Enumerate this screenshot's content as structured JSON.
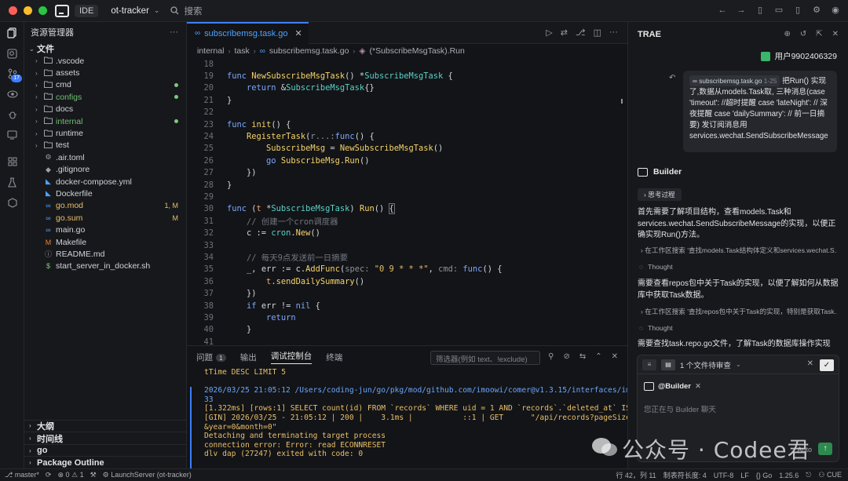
{
  "titlebar": {
    "ide_label": "IDE",
    "project": "ot-tracker",
    "search_placeholder": "搜索"
  },
  "activity": {
    "badge": "17"
  },
  "explorer": {
    "title": "资源管理器",
    "section": "文件",
    "items": [
      {
        "name": ".vscode",
        "type": "folder",
        "color": "#cfd3da"
      },
      {
        "name": "assets",
        "type": "folder",
        "color": "#cfd3da"
      },
      {
        "name": "cmd",
        "type": "folder",
        "color": "#cfd3da",
        "dot": "#7ec97e"
      },
      {
        "name": "configs",
        "type": "folder",
        "color": "#6fbf73",
        "dot": "#7ec97e"
      },
      {
        "name": "docs",
        "type": "folder",
        "color": "#cfd3da"
      },
      {
        "name": "internal",
        "type": "folder",
        "color": "#6fbf73",
        "dot": "#7ec97e"
      },
      {
        "name": "runtime",
        "type": "folder",
        "color": "#cfd3da"
      },
      {
        "name": "test",
        "type": "folder",
        "color": "#cfd3da"
      },
      {
        "name": ".air.toml",
        "type": "file",
        "color": "#cfd3da",
        "icon": "⚙"
      },
      {
        "name": ".gitignore",
        "type": "file",
        "color": "#cfd3da",
        "icon": "◆"
      },
      {
        "name": "docker-compose.yml",
        "type": "file",
        "color": "#cfd3da",
        "icon": "🐳"
      },
      {
        "name": "Dockerfile",
        "type": "file",
        "color": "#cfd3da",
        "icon": "🐳"
      },
      {
        "name": "go.mod",
        "type": "file",
        "color": "#e8bf6a",
        "icon": "∞",
        "badge": "1, M"
      },
      {
        "name": "go.sum",
        "type": "file",
        "color": "#e8bf6a",
        "icon": "∞",
        "badge": "M"
      },
      {
        "name": "main.go",
        "type": "file",
        "color": "#cfd3da",
        "icon": "∞"
      },
      {
        "name": "Makefile",
        "type": "file",
        "color": "#cfd3da",
        "icon": "M"
      },
      {
        "name": "README.md",
        "type": "file",
        "color": "#cfd3da",
        "icon": "ⓘ"
      },
      {
        "name": "start_server_in_docker.sh",
        "type": "file",
        "color": "#cfd3da",
        "icon": "$"
      }
    ],
    "bottom_sections": [
      "大纲",
      "时间线",
      "go",
      "Package Outline"
    ]
  },
  "editor": {
    "tab": "subscribemsg.task.go",
    "breadcrumbs": [
      "internal",
      "task",
      "subscribemsg.task.go",
      "(*SubscribeMsgTask).Run"
    ]
  },
  "panel": {
    "tabs": [
      "问题",
      "输出",
      "调试控制台",
      "终端"
    ],
    "problems_badge": "1",
    "filter_placeholder": "筛选器(例如 text、!exclude)",
    "console": [
      "tTime DESC LIMIT 5",
      "",
      "2026/03/25 21:05:12 /Users/coding-jun/go/pkg/mod/github.com/imoowi/comer@v1.3.15/interfaces/impl/repo.go:",
      "33",
      "[1.322ms] [rows:1] SELECT count(id) FROM `records` WHERE uid = 1 AND `records`.`deleted_at` IS NULL",
      "[GIN] 2026/03/25 - 21:05:12 | 200 |    3.1ms |           ::1 | GET      \"/api/records?pageSize=5&page=1",
      "&year=0&month=0\"",
      "Detaching and terminating target process",
      "connection error: Error: read ECONNRESET",
      "dlv dap (27247) exited with code: 0"
    ]
  },
  "chat": {
    "title": "TRAE",
    "user": "用户9902406329",
    "user_message_chip": "subscribemsg.task.go",
    "user_message_chip_range": "1-25",
    "user_message": "把Run() 实现了,数据从models.Task取, 三种消息(case 'timeout': //超时提醒 case 'lateNight': // 深夜提醒 case 'dailySummary': // 前一日摘要) 发订阅消息用 services.wechat.SendSubscribeMessage",
    "builder": "Builder",
    "think_label": "思考过程",
    "para1": "首先需要了解项目结构，查看models.Task和services.wechat.SendSubscribeMessage的实现，以便正确实现Run()方法。",
    "step1": "在工作区搜索 '查找models.Task结构体定义和services.wechat.S...",
    "thought": "Thought",
    "para2": "需要查看repos包中关于Task的实现，以便了解如何从数据库中获取Task数据。",
    "step2": "在工作区搜索 '查找repos包中关于Task的实现，特别是获取Task...",
    "para3": "需要查找task.repo.go文件，了解Task的数据库操作实现",
    "review_label": "1 个文件待审查",
    "input_builder": "@Builder",
    "input_placeholder": "您正在与 Builder 聊天",
    "auto_label": "Auto"
  },
  "watermark": "公众号 · Codee君",
  "statusbar": {
    "branch": "master*",
    "errors": "0",
    "warnings": "1",
    "launch": "LaunchServer (ot-tracker)",
    "position": "行 42，列 11",
    "tab_size": "制表符长度: 4",
    "encoding": "UTF-8",
    "eol": "LF",
    "language": "Go",
    "go_version": "1.25.6",
    "cue": "CUE"
  }
}
